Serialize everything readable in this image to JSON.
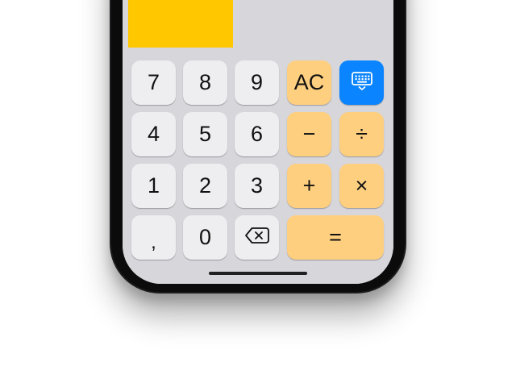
{
  "keypad": {
    "rows": [
      [
        {
          "label": "7",
          "type": "digit"
        },
        {
          "label": "8",
          "type": "digit"
        },
        {
          "label": "9",
          "type": "digit"
        },
        {
          "label": "AC",
          "type": "op"
        },
        {
          "icon": "keyboard-icon",
          "type": "blue"
        }
      ],
      [
        {
          "label": "4",
          "type": "digit"
        },
        {
          "label": "5",
          "type": "digit"
        },
        {
          "label": "6",
          "type": "digit"
        },
        {
          "label": "−",
          "type": "op"
        },
        {
          "label": "÷",
          "type": "op"
        }
      ],
      [
        {
          "label": "1",
          "type": "digit"
        },
        {
          "label": "2",
          "type": "digit"
        },
        {
          "label": "3",
          "type": "digit"
        },
        {
          "label": "+",
          "type": "op"
        },
        {
          "label": "×",
          "type": "op"
        }
      ],
      [
        {
          "label": ",",
          "type": "digit"
        },
        {
          "label": "0",
          "type": "digit"
        },
        {
          "icon": "backspace-icon",
          "type": "digit"
        },
        {
          "label": "=",
          "type": "op"
        }
      ]
    ]
  },
  "colors": {
    "operator_key": "#ffcf80",
    "digit_key": "#eeeef1",
    "keyboard_key": "#0a84ff",
    "highlight_block": "#ffc700",
    "keyboard_background": "#d6d6db"
  }
}
